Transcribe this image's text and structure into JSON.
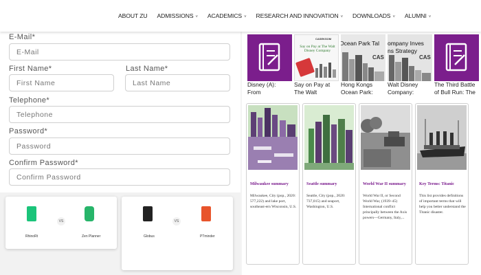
{
  "nav": {
    "items": [
      "ABOUT ZU",
      "ADMISSIONS",
      "ACADEMICS",
      "RESEARCH AND INNOVATION",
      "DOWNLOADS",
      "ALUMNI"
    ]
  },
  "form": {
    "email_label": "E-Mail*",
    "email_placeholder": "E-Mail",
    "first_name_label": "First Name*",
    "first_name_placeholder": "First Name",
    "last_name_label": "Last Name*",
    "last_name_placeholder": "Last Name",
    "telephone_label": "Telephone*",
    "telephone_placeholder": "Telephone",
    "password_label": "Password*",
    "password_placeholder": "Password",
    "confirm_label": "Confirm Password*",
    "confirm_placeholder": "Confirm Password"
  },
  "comparisons": [
    {
      "left": "RhinoRt",
      "right": "Zen Planner",
      "vs": "VS"
    },
    {
      "left": "Globus",
      "right": "PTminder",
      "vs": "VS"
    }
  ],
  "cases": [
    {
      "title1": "Disney (A):",
      "title2": "From"
    },
    {
      "title1": "Say on Pay at",
      "title2": "The Walt",
      "cover_text": "Say on Pay at The Walt Disney Company",
      "brand": "CASEKSOM"
    },
    {
      "title1": "Hong Kongs",
      "title2": "Ocean Park:",
      "cover_text": "Ocean Park Tal",
      "brand": "CAS"
    },
    {
      "title1": "Walt Disney",
      "title2": "Company:",
      "cover_text": "ompany Inves ns Strategy",
      "brand": "CAS"
    },
    {
      "title1": "The Third Battle",
      "title2": "of Bull Run: The"
    }
  ],
  "summaries": [
    {
      "title": "Milwaukee summary",
      "desc": "Milwaukee, City (pop., 2020: 577,222) and lake port, southeast-ern Wisconsin, U.S."
    },
    {
      "title": "Seattle summary",
      "desc": "Seattle, City (pop., 2020: 737,015) and seaport, Washington, U.S."
    },
    {
      "title": "World War II summary",
      "desc": "World War II, or Second World War, (1939–45) International conflict principally between the Axis powers—Germany, Italy,..."
    },
    {
      "title": "Key Terms: Titanic",
      "desc": "This list provides definitions of important terms that will help you better understand the Titanic disaster."
    }
  ],
  "colors": {
    "purple": "#7b1e8c",
    "summary_title": "#7a1b8d",
    "nav_text": "#222222"
  }
}
